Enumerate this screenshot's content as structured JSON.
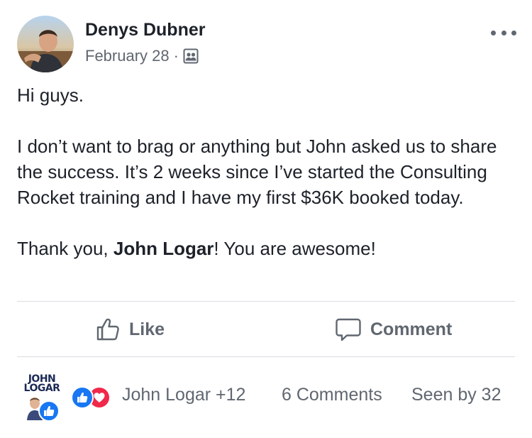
{
  "post": {
    "author": "Denys Dubner",
    "date": "February 28",
    "separator": "·",
    "audience_icon": "group-icon",
    "body": {
      "greeting": "Hi guys.",
      "paragraph": "I don’t want to brag or anything but John asked us to share the success. It’s 2 weeks since I’ve started the Consulting Rocket training and I have my first $36K booked today.",
      "thanks_prefix": "Thank you, ",
      "mention": "John Logar",
      "thanks_suffix": "! You are awesome!"
    }
  },
  "actions": {
    "like_label": "Like",
    "comment_label": "Comment"
  },
  "footer": {
    "page_logo_text": "JOHN LOGAR",
    "reactors": "John Logar +12",
    "comments": "6 Comments",
    "seen_by": "Seen by 32"
  },
  "colors": {
    "text": "#1d2129",
    "secondary": "#606770",
    "like_blue": "#1877f2",
    "love_red": "#f0284a",
    "divider": "#dadde1"
  }
}
